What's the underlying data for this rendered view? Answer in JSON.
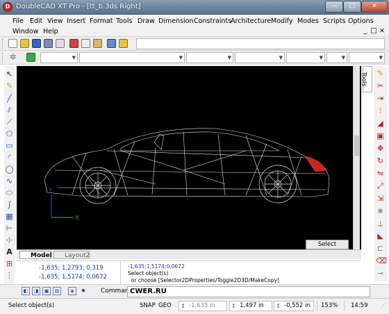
{
  "window": {
    "title": "DoubleCAD XT Pro - [tt_b.3ds Right]",
    "app_icon": "D",
    "min": "—",
    "max": "□",
    "close": "✕"
  },
  "menu": [
    "File",
    "Edit",
    "View",
    "Insert",
    "Format",
    "Tools",
    "Draw",
    "Dimension",
    "Constraints",
    "Architecture",
    "Modify",
    "Modes",
    "Scripts",
    "Options",
    "Window",
    "Help"
  ],
  "mdi": {
    "min": "_",
    "restore": "□",
    "close": "×"
  },
  "viewport": {
    "axis_y": "Y",
    "axis_x": "X",
    "tooltip": "Select object(s)"
  },
  "tools_tab": "Tools",
  "layout_tabs": {
    "model": "Model",
    "layout2": "Layout2"
  },
  "history": {
    "coords": [
      "-1,635; 1,2793; 0,319",
      "-1,635; 1,5174; 0,0672"
    ],
    "messages": [
      "-1,635;1,5174;0,0672",
      "Select object(s)",
      "  or choose [Selector2DProperties/Toggle2D3D/MakeCopy]"
    ]
  },
  "command": {
    "label": "Command:",
    "value": "CWER.RU"
  },
  "status": {
    "message": "Select object(s)",
    "snap": "SNAP",
    "geo": "GEO",
    "x_value": "-1,635 in",
    "y_value": "1,497 in",
    "z_value": "-0,552 in",
    "zoom": "153%",
    "time": "14:59"
  },
  "colors": {
    "wire": "#e6e6e6",
    "taillight": "#cc2222",
    "axis_y": "#2a3cff",
    "axis_x": "#22aa22"
  }
}
